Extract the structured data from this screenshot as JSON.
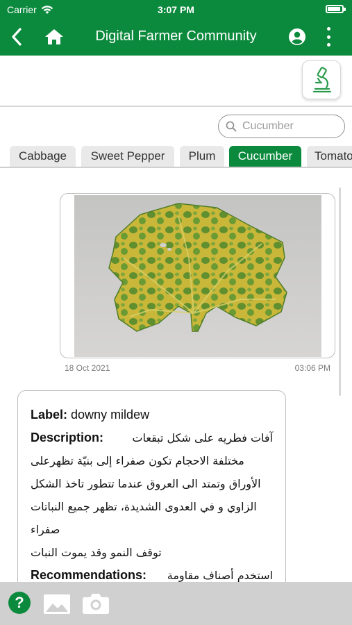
{
  "status_bar": {
    "carrier": "Carrier",
    "time": "3:07 PM"
  },
  "header": {
    "title": "Digital Farmer Community"
  },
  "search": {
    "placeholder": "Cucumber"
  },
  "tabs": [
    {
      "label": "Cabbage",
      "active": false
    },
    {
      "label": "Sweet Pepper",
      "active": false
    },
    {
      "label": "Plum",
      "active": false
    },
    {
      "label": "Cucumber",
      "active": true
    },
    {
      "label": "Tomato",
      "active": false
    }
  ],
  "post": {
    "date": "18 Oct 2021",
    "time": "03:06 PM",
    "label_key": "Label:",
    "label_value": "downy mildew",
    "description_key": "Description:",
    "description_lines": [
      "آفات فطريه على شكل تبقعات",
      "مختلفة الاحجام  تكون صفراء إلى بنيّة تظهرعلى",
      "الأوراق وتمتد الى العروق عندما تتطور تاخذ الشكل",
      "الزاوي و في العدوى الشديدة، تظهر جميع النباتات",
      "صفراء",
      "توقف النمو وقد يموت النبات"
    ],
    "recommendations_key": "Recommendations:",
    "recommendations_first": "استخدم أصناف مقاومة"
  },
  "colors": {
    "brand_green": "#0b8a3d",
    "toolbar_gray": "#d0d0d0"
  },
  "icons": [
    "back-icon",
    "home-icon",
    "profile-icon",
    "more-vert-icon",
    "microscope-icon",
    "search-icon",
    "help-icon",
    "gallery-icon",
    "camera-icon"
  ]
}
